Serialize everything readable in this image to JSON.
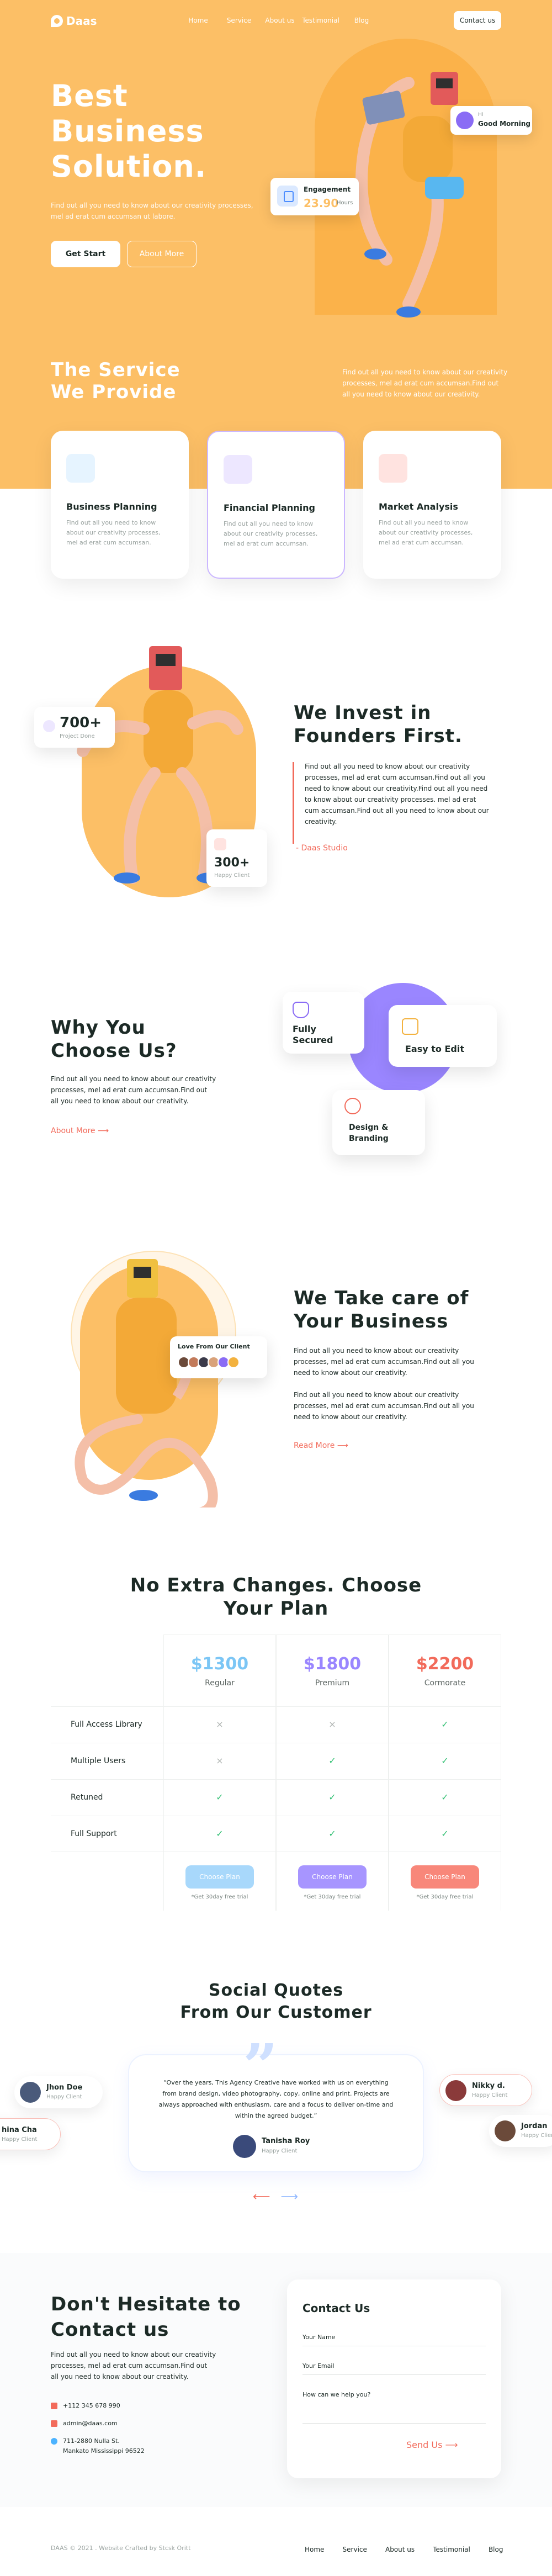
{
  "nav": {
    "logo": "Daas",
    "items": [
      "Home",
      "Service",
      "About us",
      "Testimonial",
      "Blog"
    ],
    "contact_button": "Contact us"
  },
  "hero": {
    "title_lines": [
      "Best",
      "Business",
      "Solution."
    ],
    "description": "Find out all you need to know about our creativity processes, mel ad erat cum accumsan ut labore.",
    "start_button": "Get Start",
    "more_button": "About More",
    "engagement": {
      "label": "Engagement",
      "value": "23.90",
      "unit": "Hours"
    },
    "greeting": {
      "small": "Hi",
      "big": "Good Morning"
    }
  },
  "service": {
    "title_lines": [
      "The Service",
      "We Provide"
    ],
    "description": "Find out all you need to know about our creativity processes, mel ad erat cum accumsan.Find out all you need to know about our creativity.",
    "cards": [
      {
        "name": "Business Planning",
        "text": "Find out all you need to know about our creativity processes, mel ad erat cum accumsan.",
        "icon": "briefcase-icon",
        "color": "#e6f4ff",
        "accent": "#4cb3ff"
      },
      {
        "name": "Financial Planning",
        "text": "Find out all you need to know about our creativity processes, mel ad erat cum accumsan.",
        "icon": "chart-icon",
        "color": "#ede7ff",
        "accent": "#8a6cf5"
      },
      {
        "name": "Market Analysis",
        "text": "Find out all you need to know about our creativity processes, mel ad erat cum accumsan.",
        "icon": "target-icon",
        "color": "#ffe3e0",
        "accent": "#f26b5b"
      }
    ]
  },
  "invest": {
    "stat1": {
      "value": "700+",
      "label": "Project Done"
    },
    "stat2": {
      "value": "300+",
      "label": "Happy Client"
    },
    "title_lines": [
      "We Invest in",
      "Founders First."
    ],
    "text": "Find out all you need to know about our creativity processes, mel ad erat cum accumsan.Find out all you need to know about our creativity.Find out all you need to know about our creativity processes. mel ad erat cum accumsan.Find out all you need to know about our creativity.",
    "link": "- Daas Studio"
  },
  "why": {
    "title_lines": [
      "Why You",
      "Choose Us?"
    ],
    "text": "Find out all you need to know about our creativity processes, mel ad erat cum accumsan.Find out all you need to know about our creativity.",
    "link": "About More",
    "features": [
      {
        "title_lines": [
          "Fully",
          "Secured"
        ],
        "icon": "shield-icon",
        "accent": "#8a6cf5"
      },
      {
        "title_lines": [
          "Easy to Edit",
          ""
        ],
        "icon": "edit-icon",
        "accent": "#f3b23f"
      },
      {
        "title_lines": [
          "Design &",
          "Branding"
        ],
        "icon": "brush-icon",
        "accent": "#f26b5b"
      }
    ]
  },
  "care": {
    "title_lines": [
      "We Take care of",
      "Your Business"
    ],
    "text1": "Find out all you need to know about our creativity processes, mel ad erat cum accumsan.Find out all you need to know about our creativity.",
    "text2": "Find out all you need to know about our creativity processes, mel ad erat cum accumsan.Find out all you need to know about our creativity.",
    "link": "Read More",
    "love_title": "Love From Our Client"
  },
  "pricing": {
    "title_lines": [
      "No Extra Changes. Choose",
      "Your Plan"
    ],
    "plans": [
      {
        "price": "$1300",
        "name": "Regular",
        "color": "#7cc6f5",
        "button": "Choose Plan",
        "note": "*Get 30day free trial",
        "btn_color": "#a8d8fb"
      },
      {
        "price": "$1800",
        "name": "Premium",
        "color": "#9a86ff",
        "button": "Choose Plan",
        "note": "*Get 30day free trial",
        "btn_color": "#a795ff"
      },
      {
        "price": "$2200",
        "name": "Cormorate",
        "color": "#f26b5b",
        "button": "Choose Plan",
        "note": "*Get 30day free trial",
        "btn_color": "#f8877a"
      }
    ],
    "features": [
      {
        "label": "Full Access Library",
        "marks": [
          "×",
          "×",
          "✓"
        ]
      },
      {
        "label": "Multiple Users",
        "marks": [
          "×",
          "✓",
          "✓"
        ]
      },
      {
        "label": "Retuned",
        "marks": [
          "✓",
          "✓",
          "✓"
        ]
      },
      {
        "label": "Full Support",
        "marks": [
          "✓",
          "✓",
          "✓"
        ]
      }
    ]
  },
  "social": {
    "title_lines": [
      "Social Quotes",
      "From Our Customer"
    ],
    "quote": "“Over the years, This Agency Creative have worked with us on everything from brand design, video photography, copy, online and print. Projects are always approached with enthusiasm, care and a focus to deliver on-time and within the agreed budget.”",
    "author": {
      "name": "Tanisha Roy",
      "role": "Happy Client"
    },
    "people": [
      {
        "name": "Jhon Doe",
        "role": "Happy Client"
      },
      {
        "name": "hina Cha",
        "role": "Happy Client"
      },
      {
        "name": "Nikky d.",
        "role": "Happy Client"
      },
      {
        "name": "Jordan",
        "role": "Happy Client"
      }
    ]
  },
  "contact": {
    "title_lines": [
      "Don't Hesitate to",
      "Contact us"
    ],
    "text": "Find out all you need to know about our creativity processes, mel ad erat cum accumsan.Find out all you need to know about our creativity.",
    "phone": "+112 345 678 990",
    "email": "admin@daas.com",
    "address_lines": [
      "711-2880 Nulla St.",
      "Mankato Mississippi 96522"
    ],
    "form": {
      "title": "Contact Us",
      "name_label": "Your Name",
      "email_label": "Your Email",
      "message_label": "How can we help you?",
      "send": "Send Us"
    }
  },
  "footer": {
    "copyright": "DAAS © 2021 . Website Crafted by Stcsk Oritt",
    "links": [
      "Home",
      "Service",
      "About us",
      "Testimonial",
      "Blog"
    ]
  }
}
